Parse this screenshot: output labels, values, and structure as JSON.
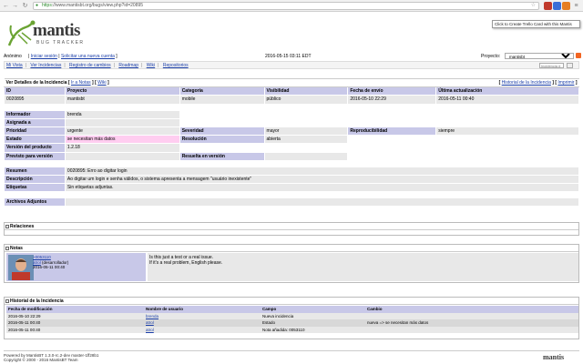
{
  "browser": {
    "https": "https",
    "url_rest": "://www.mantisbt.org/bugs/view.php?id=20895",
    "tooltip": "Click to Create Trello Card with this Mantis"
  },
  "brand": {
    "word": "mantis",
    "sub": "BUG TRACKER",
    "footer_word": "mantis"
  },
  "topbar": {
    "user": "Anónimo",
    "login": "Iniciar sesión",
    "signup": "Solicitar una nueva cuenta",
    "time": "2016-05-15 03:11 EDT",
    "project_label": "Proyecto:",
    "project_value": "mantisbt"
  },
  "menu": {
    "items": [
      "Mi Vista",
      "Ver Incidencias",
      "Registro de cambios",
      "Roadmap",
      "Wiki",
      "Repositorios"
    ],
    "search_placeholder": "Incidencia #"
  },
  "details": {
    "title": "Ver Detalles de la Incidencia",
    "links": [
      "Ir a Notas",
      "Wiki"
    ],
    "right_links": [
      "Historial de la Incidencia",
      "Imprimir"
    ],
    "columns": [
      "ID",
      "Proyecto",
      "Categoría",
      "Visibilidad",
      "Fecha de envío",
      "Última actualización"
    ],
    "id": "0020895",
    "project": "mantisbt",
    "category": "mobile",
    "visibility": "público",
    "submitted": "2016-05-10 22:29",
    "updated": "2016-05-11 00:40",
    "reporter_label": "Informador",
    "reporter": "brenda",
    "assigned_label": "Asignada a",
    "priority_label": "Prioridad",
    "priority": "urgente",
    "severity_label": "Severidad",
    "severity": "mayor",
    "repro_label": "Reproducibilidad",
    "repro": "siempre",
    "status_label": "Estado",
    "status": "se necesitan más datos",
    "resolution_label": "Resolución",
    "resolution": "abierta",
    "version_label": "Versión del producto",
    "version": "1.2.18",
    "target_label": "Previsto para versión",
    "fixed_label": "Resuelta en versión",
    "summary_label": "Resumen",
    "summary": "0020895: Erro ao digitar login",
    "description_label": "Descripción",
    "description": "Ao digitar um login e senha válidos, o sistema apresenta a mensagem \"usuário inexistente\"",
    "tags_label": "Etiquetas",
    "tags": "Sin etiquetas adjuntas.",
    "attach_label": "Archivos Adjuntos"
  },
  "relations": {
    "title": "Relaciones"
  },
  "notes": {
    "title": "Notas",
    "note_id": "~0053110",
    "author": "atrol",
    "role": "(desarrollador)",
    "date": "2016-05-11 00:40",
    "text_line1": "Is this just a test or a real issue.",
    "text_line2": "If it's a real problem, English please."
  },
  "history": {
    "title": "Historial de la Incidencia",
    "columns": [
      "Fecha de modificación",
      "Nombre de usuario",
      "Campo",
      "Cambio"
    ],
    "rows": [
      {
        "date": "2016-05-10 22:29",
        "user": "brenda",
        "field": "Nueva incidencia",
        "change": ""
      },
      {
        "date": "2016-05-11 00:40",
        "user": "atrol",
        "field": "Estado",
        "change": "nueva => se necesitan más datos"
      },
      {
        "date": "2016-05-11 00:40",
        "user": "atrol",
        "field": "Nota añadida: 0053110",
        "change": ""
      }
    ]
  },
  "footer": {
    "line1": "Powered by MantisBT 1.3.0-rc.2-dev master-1ff28b1",
    "line2": "Copyright © 2000 - 2016 MantisBT Team"
  },
  "colors": {
    "label_bg": "#c8c8e8",
    "row_bg": "#e8e8e8",
    "status_bg": "#ffcdf0",
    "link": "#1a3ea8"
  }
}
